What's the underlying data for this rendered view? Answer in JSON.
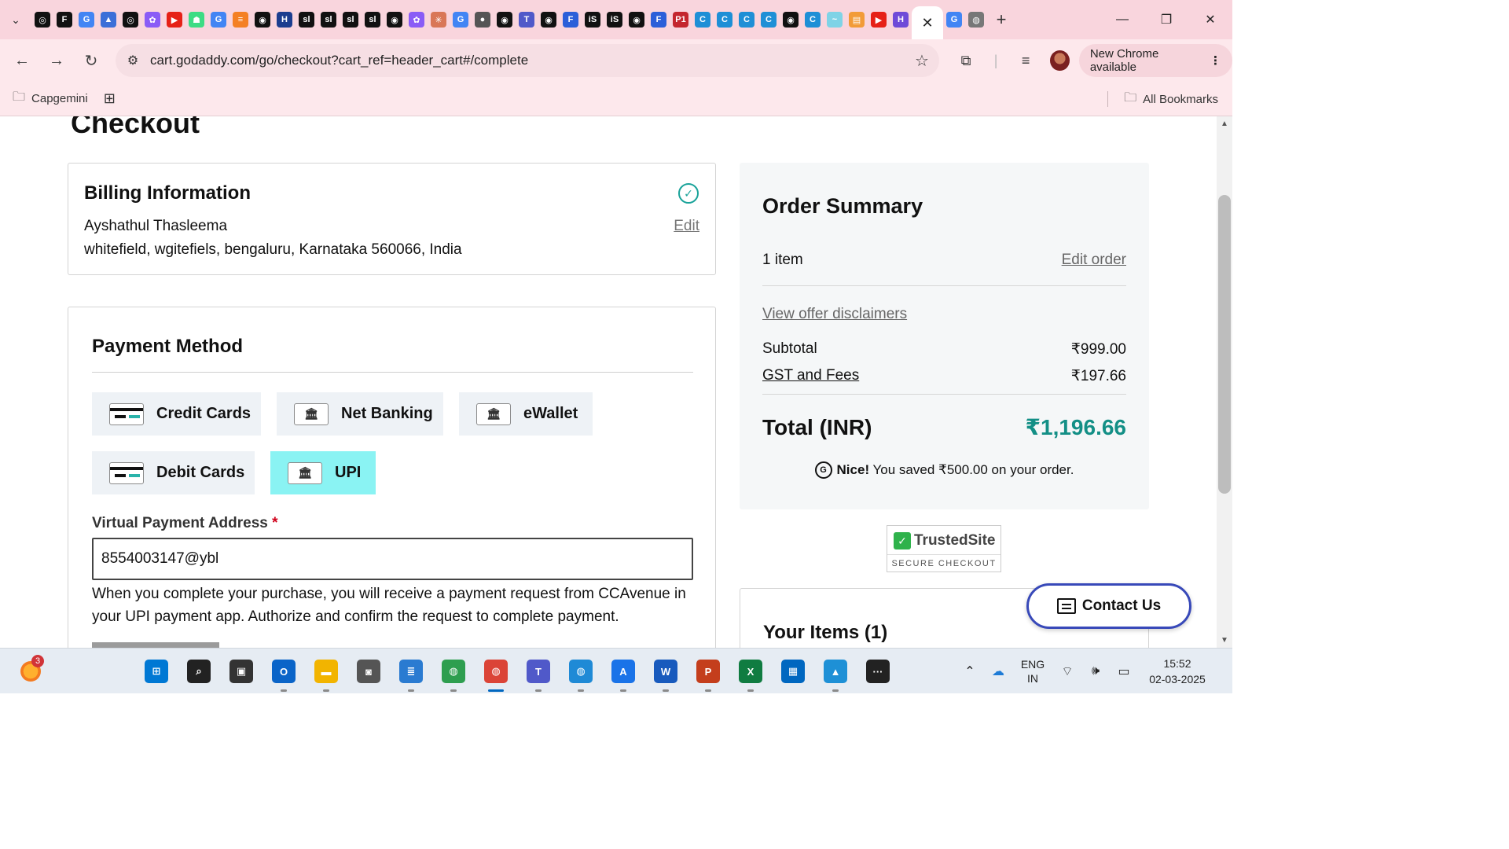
{
  "browser": {
    "tabs": [
      {
        "icon": "openai-icon",
        "color": "#111111",
        "glyph": "◎"
      },
      {
        "icon": "f-icon",
        "color": "#111111",
        "glyph": "F"
      },
      {
        "icon": "google-icon",
        "color": "#4285f4",
        "glyph": "G"
      },
      {
        "icon": "triangle-icon",
        "color": "#3b6fd8",
        "glyph": "▲"
      },
      {
        "icon": "openai-icon",
        "color": "#111111",
        "glyph": "◎"
      },
      {
        "icon": "copilot-icon",
        "color": "#8a5cf6",
        "glyph": "✿"
      },
      {
        "icon": "youtube-icon",
        "color": "#e62117",
        "glyph": "▶"
      },
      {
        "icon": "android-icon",
        "color": "#3ddc84",
        "glyph": "☗"
      },
      {
        "icon": "google-icon",
        "color": "#4285f4",
        "glyph": "G"
      },
      {
        "icon": "stackoverflow-icon",
        "color": "#f48024",
        "glyph": "≡"
      },
      {
        "icon": "github-icon",
        "color": "#111111",
        "glyph": "◉"
      },
      {
        "icon": "h-icon",
        "color": "#1c3d8f",
        "glyph": "H"
      },
      {
        "icon": "sl-icon",
        "color": "#111111",
        "glyph": "sl"
      },
      {
        "icon": "sl-icon",
        "color": "#111111",
        "glyph": "sl"
      },
      {
        "icon": "sl-icon",
        "color": "#111111",
        "glyph": "sl"
      },
      {
        "icon": "sl-icon",
        "color": "#111111",
        "glyph": "sl"
      },
      {
        "icon": "github-icon",
        "color": "#111111",
        "glyph": "◉"
      },
      {
        "icon": "copilot-icon",
        "color": "#8a5cf6",
        "glyph": "✿"
      },
      {
        "icon": "claude-icon",
        "color": "#d97757",
        "glyph": "✳"
      },
      {
        "icon": "google-icon",
        "color": "#4285f4",
        "glyph": "G"
      },
      {
        "icon": "globe-icon",
        "color": "#555555",
        "glyph": "●"
      },
      {
        "icon": "github-icon",
        "color": "#111111",
        "glyph": "◉"
      },
      {
        "icon": "teams-icon",
        "color": "#5059c9",
        "glyph": "T"
      },
      {
        "icon": "github-icon",
        "color": "#111111",
        "glyph": "◉"
      },
      {
        "icon": "forms-icon",
        "color": "#2b5fd9",
        "glyph": "F"
      },
      {
        "icon": "is-icon",
        "color": "#111111",
        "glyph": "iS"
      },
      {
        "icon": "is-icon",
        "color": "#111111",
        "glyph": "iS"
      },
      {
        "icon": "github-icon",
        "color": "#111111",
        "glyph": "◉"
      },
      {
        "icon": "forms-icon",
        "color": "#2b5fd9",
        "glyph": "F"
      },
      {
        "icon": "p1-icon",
        "color": "#c4262e",
        "glyph": "P1"
      },
      {
        "icon": "edge-icon",
        "color": "#1e8fd6",
        "glyph": "C"
      },
      {
        "icon": "edge-icon",
        "color": "#1e8fd6",
        "glyph": "C"
      },
      {
        "icon": "edge-icon",
        "color": "#1e8fd6",
        "glyph": "C"
      },
      {
        "icon": "edge-icon",
        "color": "#1e8fd6",
        "glyph": "C"
      },
      {
        "icon": "github-icon",
        "color": "#111111",
        "glyph": "◉"
      },
      {
        "icon": "edge-icon",
        "color": "#1e8fd6",
        "glyph": "C"
      },
      {
        "icon": "swirl-icon",
        "color": "#7fd3e6",
        "glyph": "~"
      },
      {
        "icon": "slides-icon",
        "color": "#f29b38",
        "glyph": "▤"
      },
      {
        "icon": "youtube-icon",
        "color": "#e62117",
        "glyph": "▶"
      },
      {
        "icon": "h-purple-icon",
        "color": "#6e4bd8",
        "glyph": "H"
      }
    ],
    "active_tab_close": "✕",
    "after_tabs": [
      {
        "icon": "google-icon",
        "color": "#4285f4",
        "glyph": "G"
      },
      {
        "icon": "chrome-icon",
        "color": "#777777",
        "glyph": "◍"
      }
    ],
    "new_tab": "+",
    "url": "cart.godaddy.com/go/checkout?cart_ref=header_cart#/complete",
    "chrome_available": "New Chrome available",
    "bookmark_folder": "Capgemini",
    "all_bookmarks": "All Bookmarks"
  },
  "page": {
    "title": "Checkout",
    "billing": {
      "heading": "Billing Information",
      "name": "Ayshathul Thasleema",
      "address": "whitefield, wgitefiels, bengaluru, Karnataka 560066, India",
      "edit": "Edit"
    },
    "payment": {
      "heading": "Payment Method",
      "options": [
        {
          "label": "Credit Cards",
          "icon": "credit-card-icon",
          "selected": false
        },
        {
          "label": "Net Banking",
          "icon": "bank-icon",
          "selected": false
        },
        {
          "label": "eWallet",
          "icon": "bank-icon",
          "selected": false
        },
        {
          "label": "Debit Cards",
          "icon": "debit-card-icon",
          "selected": false
        },
        {
          "label": "UPI",
          "icon": "bank-icon",
          "selected": true
        }
      ],
      "vpa_label": "Virtual Payment Address",
      "vpa_required": "*",
      "vpa_value": "8554003147@ybl",
      "help_text": "When you complete your purchase, you will receive a payment request from CCAvenue in your UPI payment app. Authorize and confirm the request to complete payment."
    },
    "summary": {
      "heading": "Order Summary",
      "items_count": "1 item",
      "edit_order": "Edit order",
      "offer_disclaimers": "View offer disclaimers",
      "subtotal_label": "Subtotal",
      "subtotal_value": "₹999.00",
      "gst_label": "GST and Fees",
      "gst_value": "₹197.66",
      "total_label": "Total (INR)",
      "total_value": "₹1,196.66",
      "saved_bold": "Nice!",
      "saved_text": " You saved ₹500.00 on your order."
    },
    "trusted": {
      "brand": "TrustedSite",
      "tag": "SECURE CHECKOUT"
    },
    "your_items": "Your Items (1)",
    "contact_us": "Contact Us"
  },
  "taskbar": {
    "weather_badge": "3",
    "apps": [
      {
        "name": "start-button",
        "glyph": "⊞",
        "color": "#0078d4",
        "dot": false
      },
      {
        "name": "search-icon",
        "glyph": "⌕",
        "color": "#222222",
        "dot": false
      },
      {
        "name": "task-view-icon",
        "glyph": "▣",
        "color": "#333333",
        "dot": false
      },
      {
        "name": "outlook-icon",
        "glyph": "O",
        "color": "#0a64c8",
        "dot": true
      },
      {
        "name": "file-explorer-icon",
        "glyph": "▬",
        "color": "#f2b400",
        "dot": true
      },
      {
        "name": "camera-icon",
        "glyph": "◙",
        "color": "#555555",
        "dot": false
      },
      {
        "name": "notepad-icon",
        "glyph": "≣",
        "color": "#2a7bd1",
        "dot": true
      },
      {
        "name": "chrome-icon",
        "glyph": "◍",
        "color": "#2e9e4f",
        "dot": true
      },
      {
        "name": "chrome-profile-icon",
        "glyph": "◍",
        "color": "#db4437",
        "dot": true,
        "active": true
      },
      {
        "name": "teams-icon",
        "glyph": "T",
        "color": "#5059c9",
        "dot": true
      },
      {
        "name": "chrome-alt-icon",
        "glyph": "◍",
        "color": "#1f8ad6",
        "dot": true
      },
      {
        "name": "app-store-icon",
        "glyph": "A",
        "color": "#1a73e8",
        "dot": true
      },
      {
        "name": "word-icon",
        "glyph": "W",
        "color": "#185abd",
        "dot": true
      },
      {
        "name": "powerpoint-icon",
        "glyph": "P",
        "color": "#c43e1c",
        "dot": true
      },
      {
        "name": "excel-icon",
        "glyph": "X",
        "color": "#107c41",
        "dot": true
      },
      {
        "name": "store-icon",
        "glyph": "▦",
        "color": "#0067c0",
        "dot": false
      },
      {
        "name": "photos-icon",
        "glyph": "▲",
        "color": "#1e90d6",
        "dot": true
      },
      {
        "name": "more-apps-icon",
        "glyph": "···",
        "color": "#222222",
        "dot": false
      }
    ],
    "lang_line1": "ENG",
    "lang_line2": "IN",
    "time": "15:52",
    "date": "02-03-2025"
  }
}
